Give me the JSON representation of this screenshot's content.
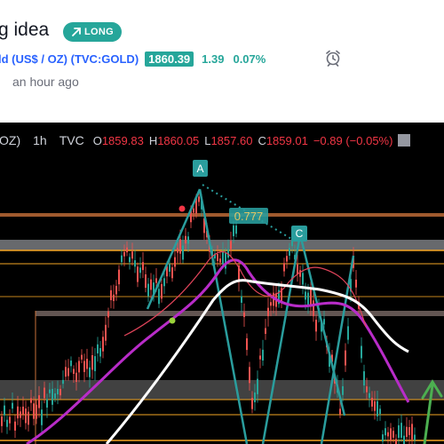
{
  "idea": {
    "title": "g idea",
    "badge_label": "LONG",
    "symbol_label": "ld (US$ / OZ) (TVC:GOLD)",
    "price": "1860.39",
    "change": "1.39",
    "change_pct": "0.07%",
    "time_ago": "an hour ago"
  },
  "toolbar": {
    "symbol": "OZ)",
    "timeframe": "1h",
    "exchange": "TVC",
    "o_key": "O",
    "o_val": "1859.83",
    "h_key": "H",
    "h_val": "1860.05",
    "l_key": "L",
    "l_val": "1857.60",
    "c_key": "C",
    "c_val": "1859.01",
    "delta": "−0.89 (−0.05%)"
  },
  "annotations": {
    "point_a": "A",
    "point_c": "C",
    "fib_ratio": "0.777"
  },
  "colors": {
    "accent_green": "#26a69a",
    "link_blue": "#2962ff",
    "down_red": "#f23645",
    "ma_white": "#ffffff",
    "ma_purple": "#b82cc8",
    "channel_teal": "#2a9d9d",
    "level_orange": "#f5a623"
  },
  "icons": [
    "arrow-up-right-icon",
    "alarm-clock-icon",
    "long-arrow-icon"
  ]
}
